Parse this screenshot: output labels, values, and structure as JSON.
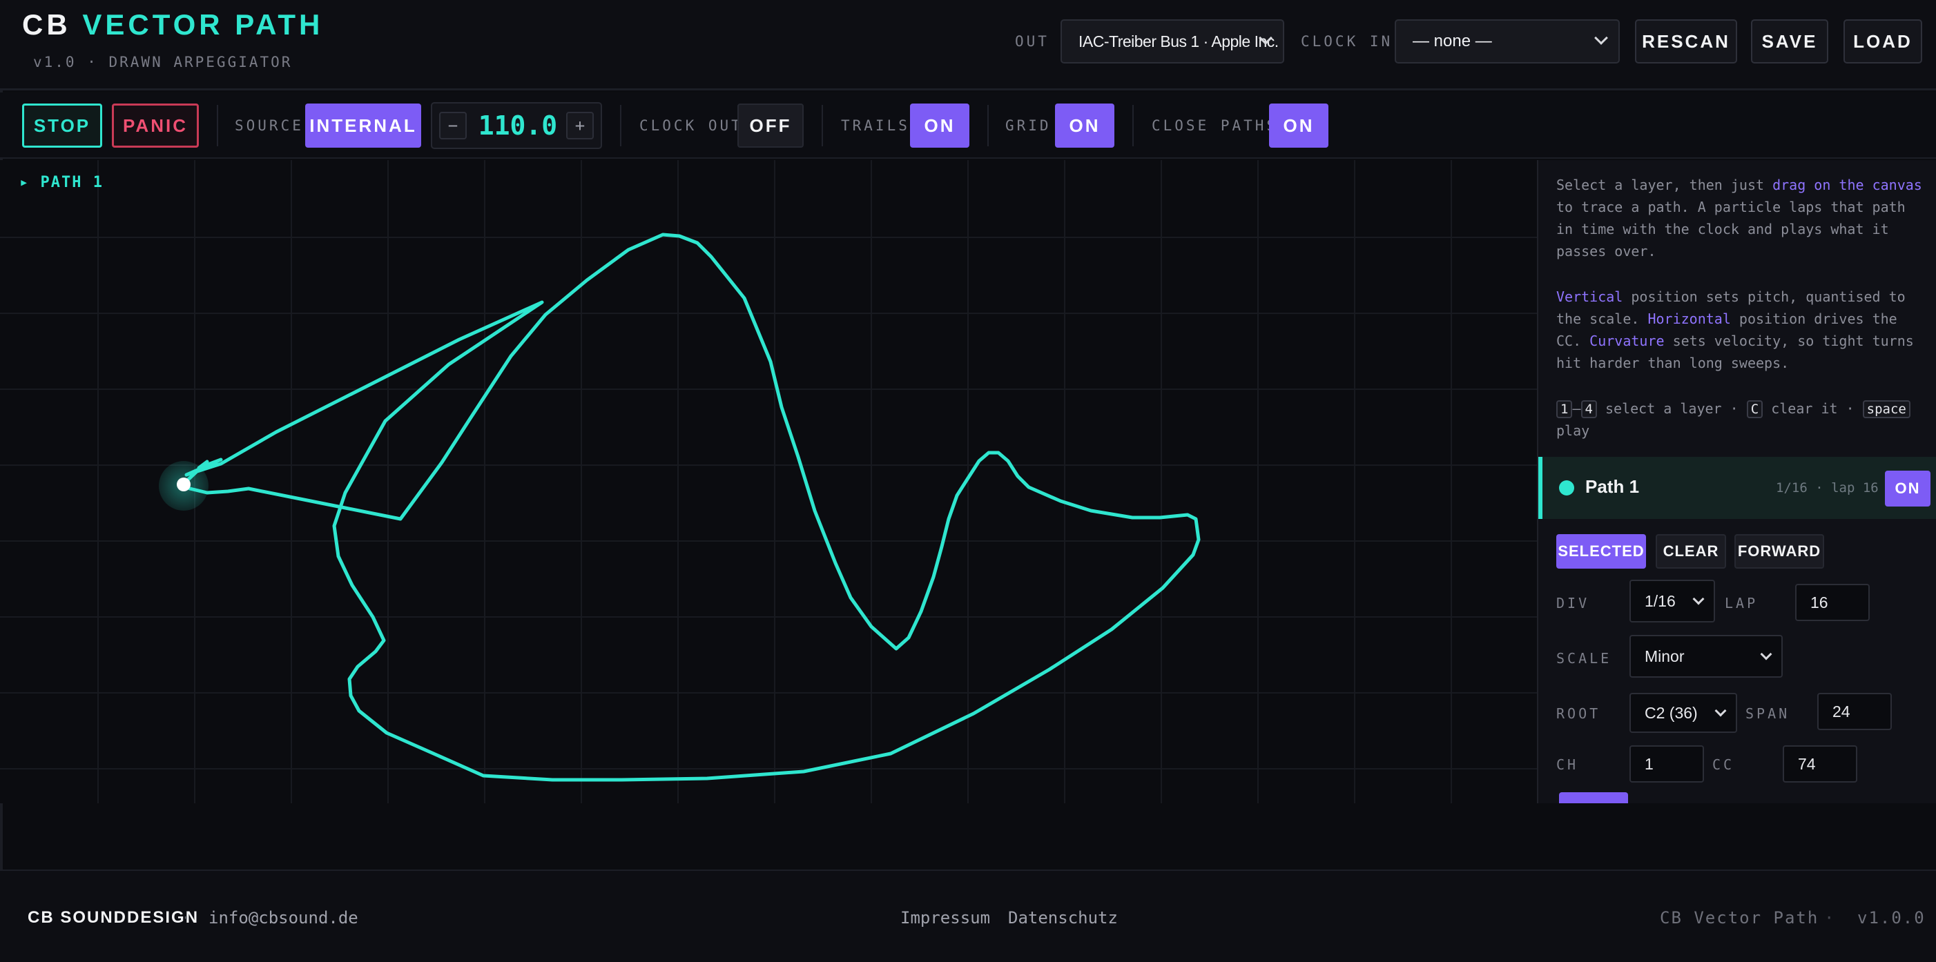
{
  "header": {
    "brand_first": "CB",
    "brand_second": "VECTOR PATH",
    "subtitle": "v1.0 · DRAWN ARPEGGIATOR",
    "out_label": "OUT",
    "out_value": "IAC-Treiber Bus 1 · Apple Inc.",
    "clock_in_label": "CLOCK IN",
    "clock_in_value": "— none —",
    "rescan_label": "RESCAN",
    "save_label": "SAVE",
    "load_label": "LOAD"
  },
  "toolbar": {
    "stop_label": "STOP",
    "panic_label": "PANIC",
    "source_label": "SOURCE",
    "source_value": "INTERNAL",
    "bpm_minus": "−",
    "bpm_value": "110.0",
    "bpm_plus": "+",
    "clock_out_label": "CLOCK OUT",
    "clock_out_value": "OFF",
    "trails_label": "TRAILS",
    "trails_value": "ON",
    "grid_label": "GRID",
    "grid_value": "ON",
    "close_paths_label": "CLOSE PATHS",
    "close_paths_value": "ON"
  },
  "canvas": {
    "path_tag": "▸ PATH 1",
    "path_color": "#2fe6cf"
  },
  "panel": {
    "help1_a": "Select a layer, then just ",
    "help1_hl": "drag on the canvas",
    "help1_b": " to trace a path. A particle laps that path in time with the clock and plays what it passes over.",
    "help2_hl1": "Vertical",
    "help2_a": " position sets pitch, quantised to the scale. ",
    "help2_hl2": "Horizontal",
    "help2_b": " position drives the CC. ",
    "help2_hl3": "Curvature",
    "help2_c": " sets velocity, so tight turns hit harder than long sweeps.",
    "key1": "1",
    "key_dash": "–",
    "key2": "4",
    "key_text1": " select a layer · ",
    "key3": "C",
    "key_text2": " clear it · ",
    "key4": "space",
    "key_text3": "play",
    "layer": {
      "name": "Path 1",
      "meta": "1/16 · lap 16",
      "on_label": "ON"
    },
    "selected_label": "SELECTED",
    "clear_label": "CLEAR",
    "forward_label": "FORWARD",
    "div_label": "DIV",
    "div_value": "1/16",
    "lap_label": "LAP",
    "lap_value": "16",
    "scale_label": "SCALE",
    "scale_value": "Minor",
    "root_label": "ROOT",
    "root_value": "C2 (36)",
    "span_label": "SPAN",
    "span_value": "24",
    "ch_label": "CH",
    "ch_value": "1",
    "cc_label": "CC",
    "cc_value": "74"
  },
  "footer": {
    "brand": "CB SOUNDDESIGN",
    "dot": "·",
    "email": "info@cbsound.de",
    "impressum": "Impressum",
    "datenschutz": "Datenschutz",
    "app": "CB Vector Path",
    "version": "v1.0.0"
  },
  "colors": {
    "accent_teal": "#2fe6cf",
    "accent_purple": "#7d5cf5",
    "panic_red": "#ef4f72",
    "background": "#0b0c10"
  }
}
